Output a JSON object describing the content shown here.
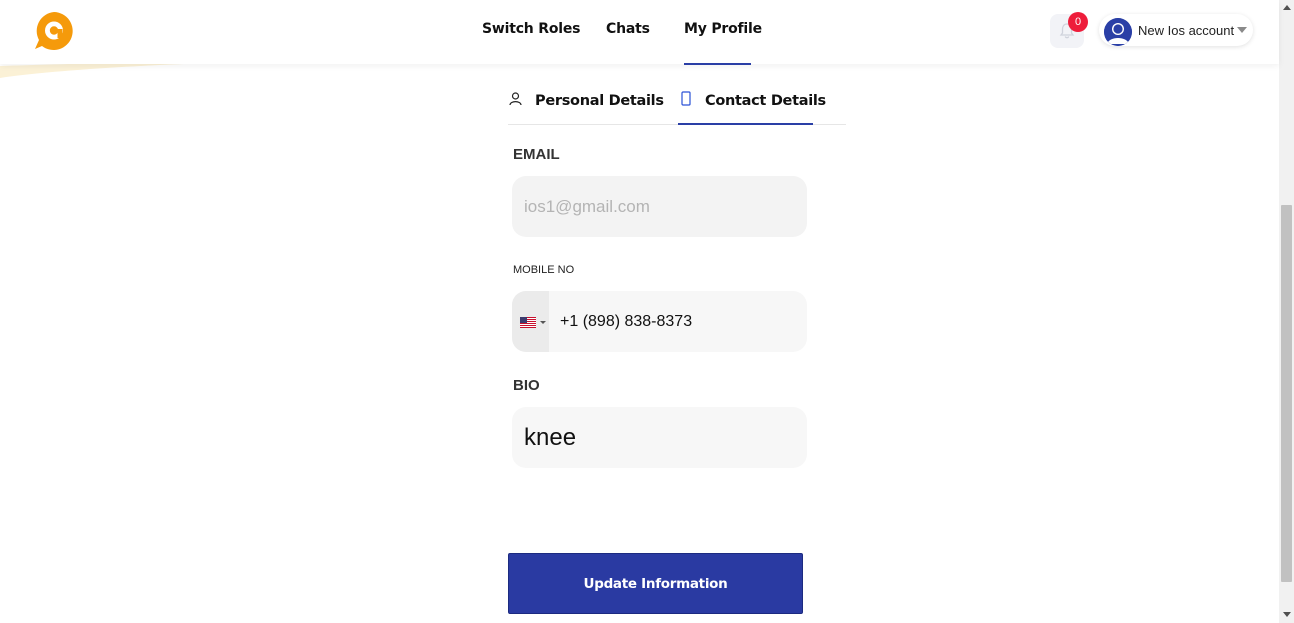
{
  "colors": {
    "brand_orange": "#f59a0b",
    "primary_blue": "#2a3aa2",
    "badge_red": "#ee1d3b",
    "field_bg": "#f4f4f4"
  },
  "header": {
    "logo_icon": "chat-bubble-logo",
    "nav": [
      {
        "label": "Switch Roles"
      },
      {
        "label": "Chats"
      },
      {
        "label": "My Profile",
        "active": true
      }
    ],
    "notifications": {
      "icon": "bell-icon",
      "count": "0"
    },
    "account": {
      "name": "New Ios account",
      "avatar_icon": "user-avatar"
    }
  },
  "tabs": [
    {
      "label": "Personal Details",
      "icon": "user-icon",
      "active": false
    },
    {
      "label": "Contact Details",
      "icon": "phone-icon",
      "active": true
    }
  ],
  "form": {
    "email": {
      "label": "EMAIL",
      "value": "ios1@gmail.com"
    },
    "mobile": {
      "label": "MOBILE NO",
      "country_flag": "us-flag",
      "value": "+1 (898) 838-8373"
    },
    "bio": {
      "label": "BIO",
      "value": "knee"
    },
    "submit_label": "Update Information"
  }
}
